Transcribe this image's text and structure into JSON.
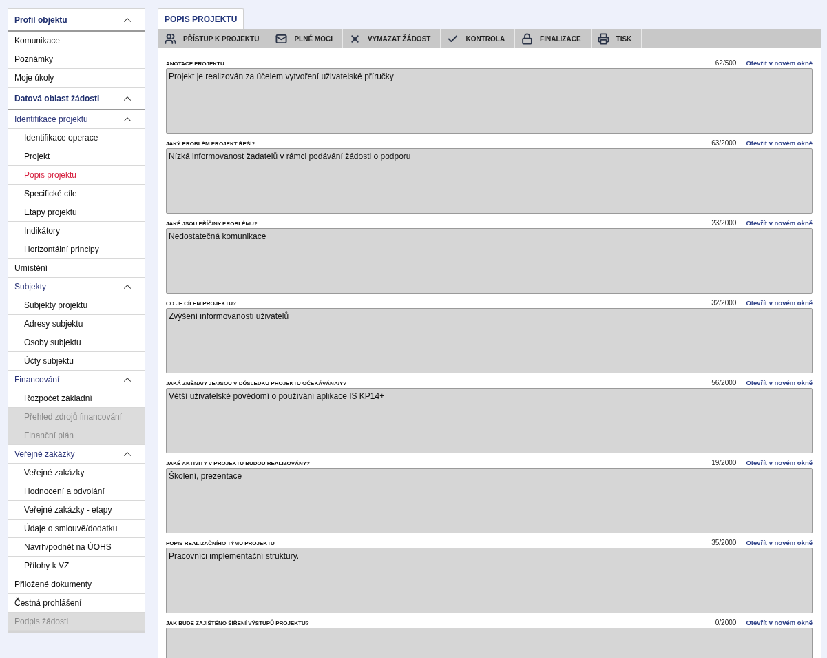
{
  "sidebar": {
    "groups": [
      {
        "label": "Profil objektu",
        "expanded": true,
        "children": [
          {
            "label": "Komunikace",
            "selected": false,
            "disabled": false
          },
          {
            "label": "Poznámky",
            "selected": false,
            "disabled": false
          },
          {
            "label": "Moje úkoly",
            "selected": false,
            "disabled": false
          }
        ]
      },
      {
        "label": "Datová oblast žádosti",
        "expanded": true,
        "children": [
          {
            "label": "Identifikace projektu",
            "selected": false,
            "disabled": false,
            "expanded": true,
            "children": [
              {
                "label": "Identifikace operace",
                "selected": false,
                "disabled": false
              },
              {
                "label": "Projekt",
                "selected": false,
                "disabled": false
              },
              {
                "label": "Popis projektu",
                "selected": true,
                "disabled": false
              },
              {
                "label": "Specifické cíle",
                "selected": false,
                "disabled": false
              },
              {
                "label": "Etapy projektu",
                "selected": false,
                "disabled": false
              },
              {
                "label": "Indikátory",
                "selected": false,
                "disabled": false
              },
              {
                "label": "Horizontální principy",
                "selected": false,
                "disabled": false
              }
            ]
          },
          {
            "label": "Umístění",
            "selected": false,
            "disabled": false
          },
          {
            "label": "Subjekty",
            "selected": false,
            "disabled": false,
            "expanded": true,
            "children": [
              {
                "label": "Subjekty projektu",
                "selected": false,
                "disabled": false
              },
              {
                "label": "Adresy subjektu",
                "selected": false,
                "disabled": false
              },
              {
                "label": "Osoby subjektu",
                "selected": false,
                "disabled": false
              },
              {
                "label": "Účty subjektu",
                "selected": false,
                "disabled": false
              }
            ]
          },
          {
            "label": "Financování",
            "selected": false,
            "disabled": false,
            "expanded": true,
            "children": [
              {
                "label": "Rozpočet základní",
                "selected": false,
                "disabled": false
              },
              {
                "label": "Přehled zdrojů financování",
                "selected": false,
                "disabled": true
              },
              {
                "label": "Finanční plán",
                "selected": false,
                "disabled": true
              }
            ]
          },
          {
            "label": "Veřejné zakázky",
            "selected": false,
            "disabled": false,
            "expanded": true,
            "children": [
              {
                "label": "Veřejné zakázky",
                "selected": false,
                "disabled": false
              },
              {
                "label": "Hodnocení a odvolání",
                "selected": false,
                "disabled": false
              },
              {
                "label": "Veřejné zakázky - etapy",
                "selected": false,
                "disabled": false
              },
              {
                "label": "Údaje o smlouvě/dodatku",
                "selected": false,
                "disabled": false
              },
              {
                "label": "Návrh/podnět na ÚOHS",
                "selected": false,
                "disabled": false
              },
              {
                "label": "Přílohy k VZ",
                "selected": false,
                "disabled": false
              }
            ]
          },
          {
            "label": "Přiložené dokumenty",
            "selected": false,
            "disabled": false
          },
          {
            "label": "Čestná prohlášení",
            "selected": false,
            "disabled": false
          },
          {
            "label": "Podpis žádosti",
            "selected": false,
            "disabled": true
          }
        ]
      }
    ]
  },
  "tabs": [
    {
      "label": "POPIS PROJEKTU",
      "selected": true
    }
  ],
  "toolbar": [
    {
      "kind": "people",
      "label": "PŘÍSTUP K PROJEKTU"
    },
    {
      "kind": "mail",
      "label": "PLNÉ MOCI"
    },
    {
      "kind": "cross",
      "label": "VYMAZAT ŽÁDOST"
    },
    {
      "kind": "check",
      "label": "KONTROLA"
    },
    {
      "kind": "lock",
      "label": "FINALIZACE"
    },
    {
      "kind": "print",
      "label": "TISK"
    }
  ],
  "fields": [
    {
      "label": "ANOTACE PROJEKTU",
      "count": "62/500",
      "link": "Otevřít v novém okně",
      "value": "Projekt je realizován za účelem vytvoření uživatelské příručky"
    },
    {
      "label": "JAKÝ PROBLÉM PROJEKT ŘEŠÍ?",
      "count": "63/2000",
      "link": "Otevřít v novém okně",
      "value": "Nízká informovanost žadatelů v rámci podávání žádosti o podporu"
    },
    {
      "label": "JAKÉ JSOU PŘÍČINY PROBLÉMU?",
      "count": "23/2000",
      "link": "Otevřít v novém okně",
      "value": "Nedostatečná komunikace"
    },
    {
      "label": "CO JE CÍLEM PROJEKTU?",
      "count": "32/2000",
      "link": "Otevřít v novém okně",
      "value": "Zvýšení informovanosti uživatelů"
    },
    {
      "label": "JAKÁ ZMĚNA/Y JE/JSOU V DŮSLEDKU PROJEKTU OČEKÁVÁNA/Y?",
      "count": "56/2000",
      "link": "Otevřít v novém okně",
      "value": "Větší uživatelské povědomí o používání aplikace IS KP14+"
    },
    {
      "label": "JAKÉ AKTIVITY V PROJEKTU BUDOU REALIZOVÁNY?",
      "count": "19/2000",
      "link": "Otevřít v novém okně",
      "value": "Školení, prezentace"
    },
    {
      "label": "POPIS REALIZAČNÍHO TÝMU PROJEKTU",
      "count": "35/2000",
      "link": "Otevřít v novém okně",
      "value": "Pracovníci implementační struktury."
    },
    {
      "label": "JAK BUDE ZAJIŠTĚNO ŠÍŘENÍ VÝSTUPŮ PROJEKTU?",
      "count": "0/2000",
      "link": "Otevřít v novém okně"
    }
  ]
}
